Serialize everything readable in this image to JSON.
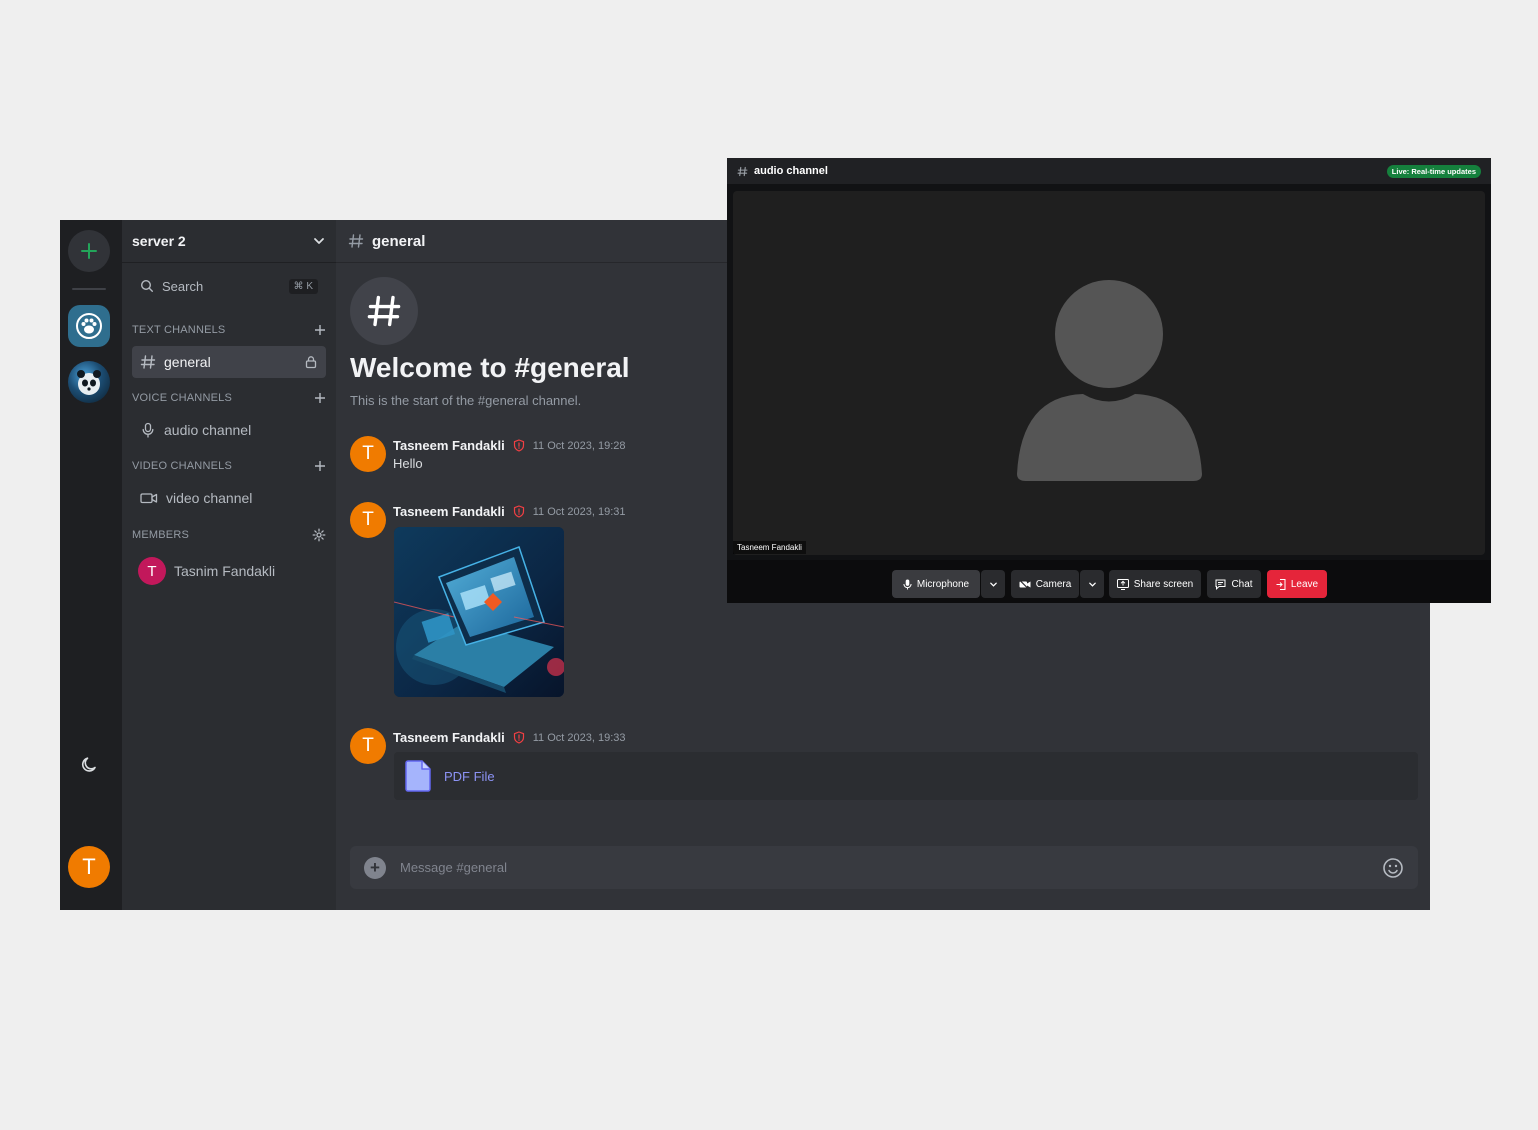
{
  "server": {
    "name": "server 2"
  },
  "search": {
    "label": "Search",
    "shortcut": "⌘ K"
  },
  "sections": {
    "text": "TEXT CHANNELS",
    "voice": "VOICE CHANNELS",
    "video": "VIDEO CHANNELS",
    "members": "MEMBERS"
  },
  "channels": {
    "text": [
      {
        "name": "general"
      }
    ],
    "voice": [
      {
        "name": "audio channel"
      }
    ],
    "video": [
      {
        "name": "video channel"
      }
    ]
  },
  "members": [
    {
      "initial": "T",
      "name": "Tasnim Fandakli"
    }
  ],
  "current_user": {
    "initial": "T"
  },
  "chat": {
    "channel": "general",
    "welcome_title": "Welcome to #general",
    "welcome_sub": "This is the start of the #general channel.",
    "messages": [
      {
        "initial": "T",
        "author": "Tasneem Fandakli",
        "time": "11 Oct 2023, 19:28",
        "text": "Hello"
      },
      {
        "initial": "T",
        "author": "Tasneem Fandakli",
        "time": "11 Oct 2023, 19:31",
        "attachment": "image"
      },
      {
        "initial": "T",
        "author": "Tasneem Fandakli",
        "time": "11 Oct 2023, 19:33",
        "file_label": "PDF File"
      }
    ],
    "composer_placeholder": "Message #general"
  },
  "call": {
    "title": "audio channel",
    "badge": "Live: Real-time updates",
    "participant": "Tasneem Fandakli",
    "controls": {
      "microphone": "Microphone",
      "camera": "Camera",
      "share": "Share screen",
      "chat": "Chat",
      "leave": "Leave"
    }
  },
  "colors": {
    "accent_green": "#23a55a",
    "avatar_orange": "#f07b00",
    "member_pink": "#c2185b",
    "link": "#8c93f5",
    "leave_red": "#e5253a",
    "live_green": "#15803d"
  }
}
